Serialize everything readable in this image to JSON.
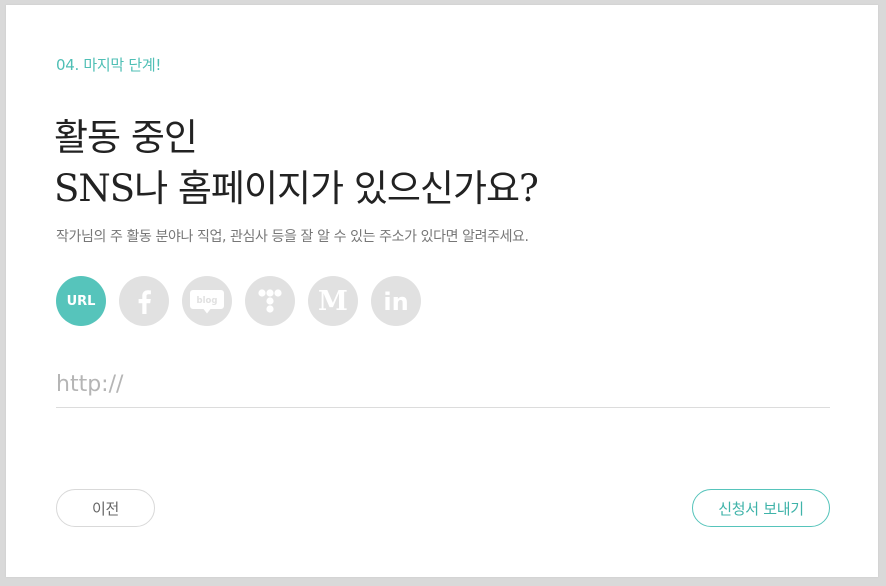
{
  "step": {
    "label": "04. 마지막 단계!"
  },
  "title": {
    "line1": "활동 중인",
    "line2": "SNS나 홈페이지가 있으신가요?"
  },
  "description": "작가님의 주 활동 분야나 직업, 관심사 등을 잘 알 수 있는 주소가 있다면 알려주세요.",
  "icons": [
    {
      "name": "url",
      "label": "URL",
      "active": true
    },
    {
      "name": "facebook-icon",
      "active": false
    },
    {
      "name": "blog-icon",
      "label": "blog",
      "active": false
    },
    {
      "name": "tistory-icon",
      "active": false
    },
    {
      "name": "medium-icon",
      "label": "M",
      "active": false
    },
    {
      "name": "linkedin-icon",
      "label": "in",
      "active": false
    }
  ],
  "url_field": {
    "placeholder": "http://",
    "value": ""
  },
  "buttons": {
    "prev": "이전",
    "send": "신청서 보내기"
  },
  "colors": {
    "accent": "#56c4bb",
    "inactive_icon": "#e1e1e1"
  }
}
